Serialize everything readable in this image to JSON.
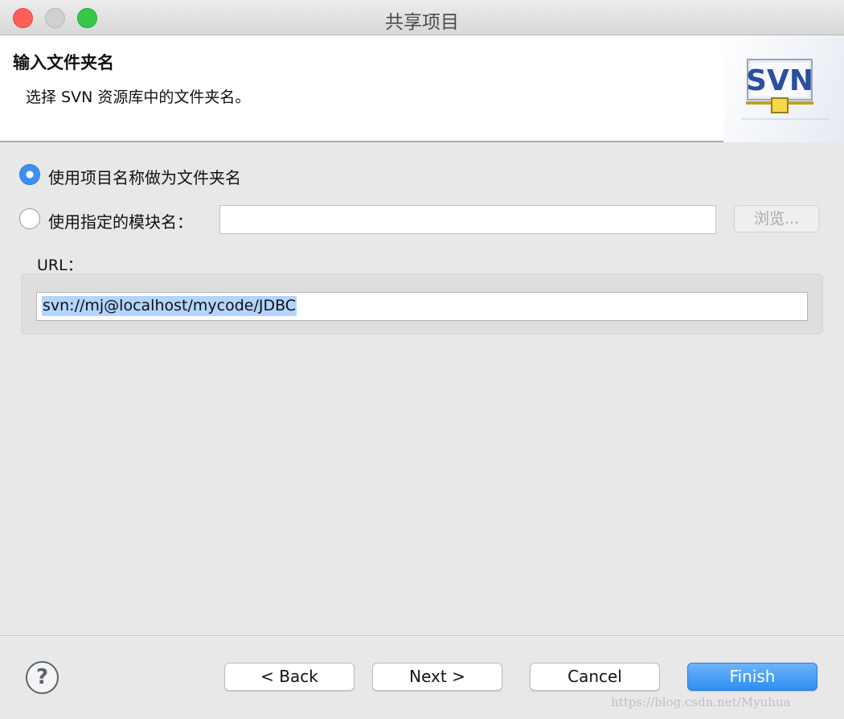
{
  "window": {
    "title": "共享项目"
  },
  "banner": {
    "title": "输入文件夹名",
    "description": "选择 SVN 资源库中的文件夹名。",
    "logo_text": "SVN"
  },
  "options": {
    "use_project_name": {
      "label": "使用项目名称做为文件夹名",
      "selected": true
    },
    "use_module_name": {
      "label": "使用指定的模块名：",
      "selected": false,
      "value": ""
    }
  },
  "browse_button": {
    "label": "浏览..."
  },
  "url": {
    "label": "URL：",
    "value": "svn://mj@localhost/mycode/JDBC"
  },
  "footer": {
    "help_label": "?",
    "back_label": "< Back",
    "next_label": "Next >",
    "cancel_label": "Cancel",
    "finish_label": "Finish"
  },
  "watermark": "https://blog.csdn.net/Myuhua",
  "colors": {
    "accent": "#3f8ff0",
    "finish": "#2f8ef0",
    "selection": "#b3d4fd"
  }
}
